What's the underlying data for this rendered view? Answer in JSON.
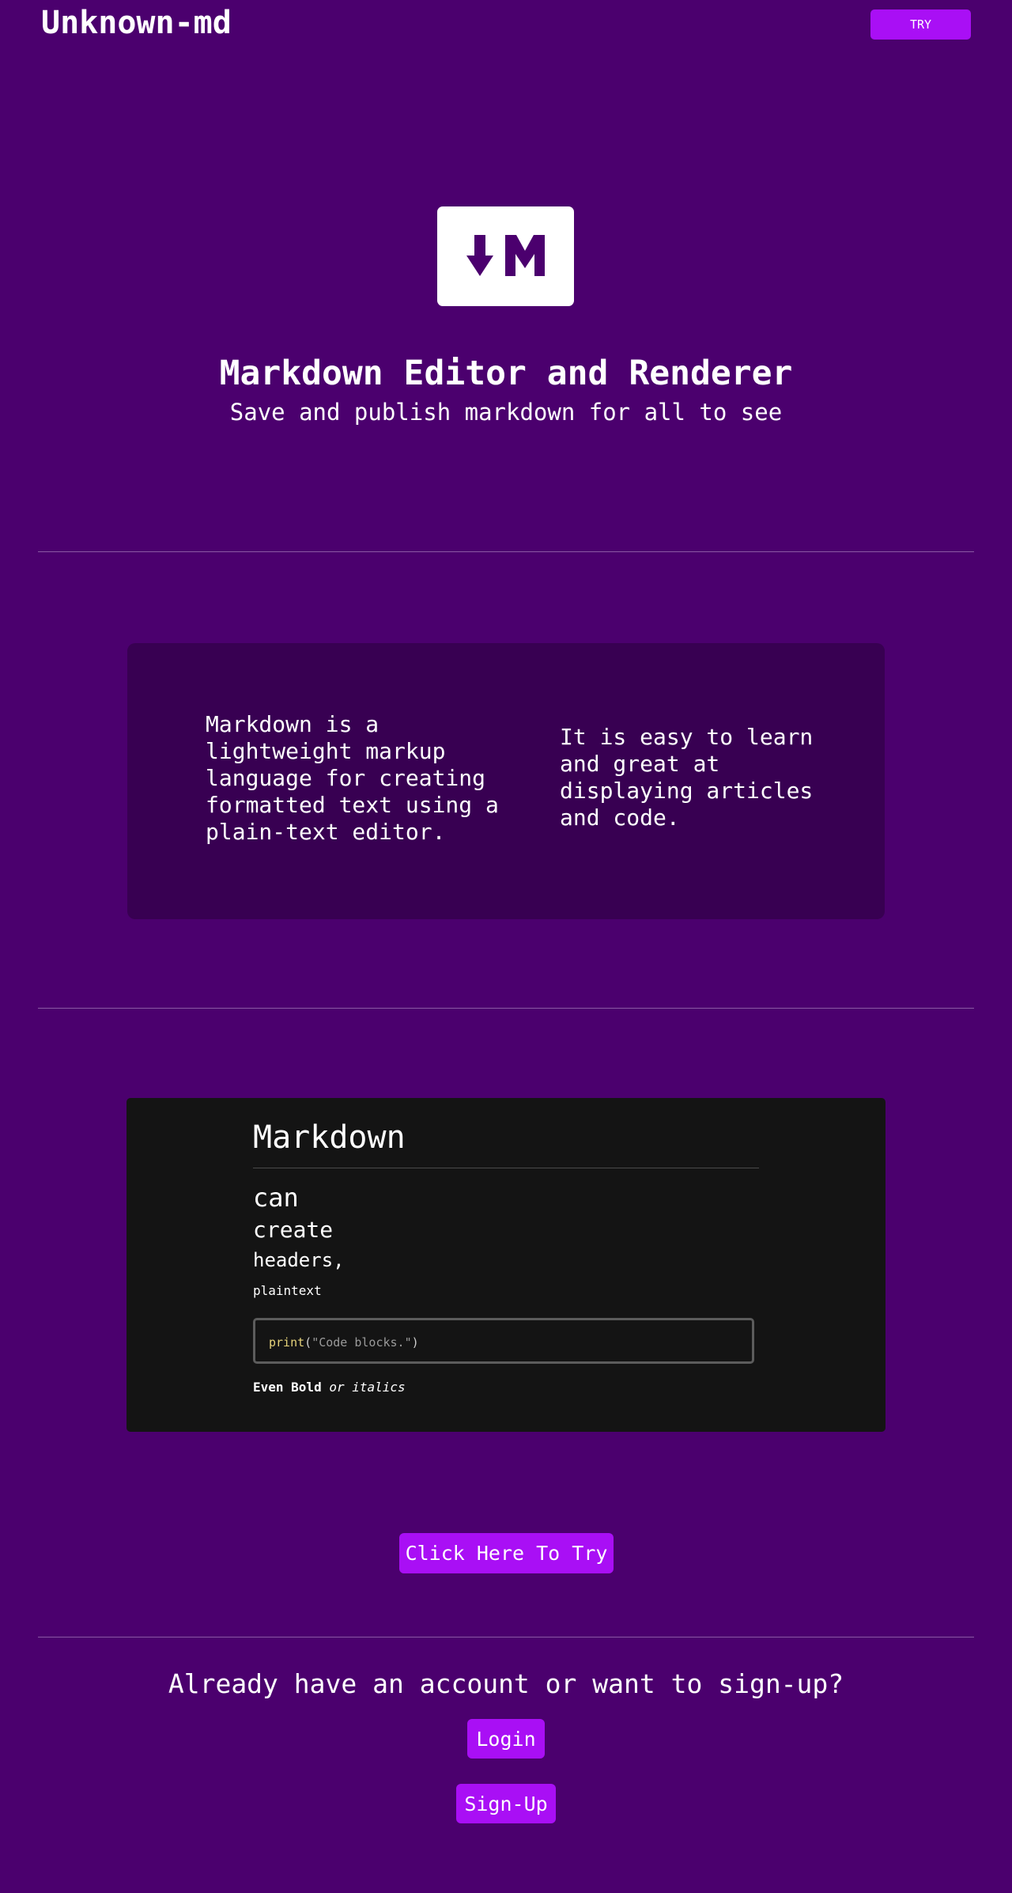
{
  "header": {
    "brand": "Unknown-md",
    "try_label": "TRY"
  },
  "hero": {
    "logo_icon": "markdown-logo-icon",
    "title": "Markdown Editor and Renderer",
    "subtitle": "Save and publish markdown for all to see"
  },
  "info": {
    "left": "Markdown is a lightweight markup language for creating formatted text using a plain-text editor.",
    "right": "It is easy to learn and great at displaying articles and code."
  },
  "demo": {
    "h1": "Markdown",
    "h2": "can",
    "h3": "create",
    "h4": "headers,",
    "paragraph": "plaintext",
    "code_fn": "print",
    "code_open": "(",
    "code_str": "\"Code blocks.\"",
    "code_close": ")",
    "bold": "Even Bold",
    "italic": "or italics"
  },
  "cta": {
    "label": "Click Here To Try"
  },
  "account": {
    "question": "Already have an account or want to sign-up?",
    "login_label": "Login",
    "signup_label": "Sign-Up"
  },
  "colors": {
    "background": "#4b006e",
    "card": "#380052",
    "accent": "#a90ff5",
    "demo_bg": "#141414"
  }
}
